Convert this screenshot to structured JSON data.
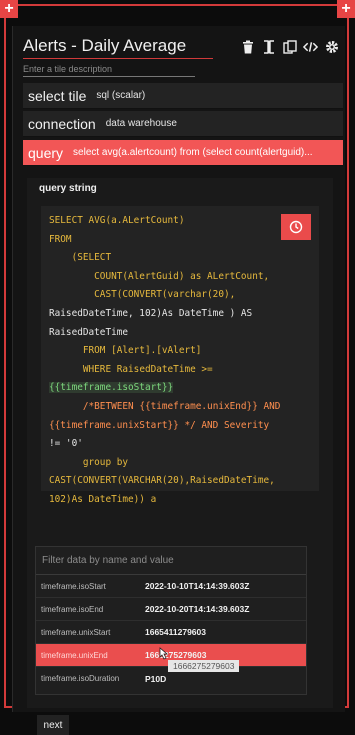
{
  "tile": {
    "title": "Alerts - Daily Average",
    "description_placeholder": "Enter a tile description"
  },
  "fields": [
    {
      "label": "select tile",
      "value": "sql (scalar)"
    },
    {
      "label": "connection",
      "value": "data warehouse"
    },
    {
      "label": "query",
      "value": "select avg(a.alertcount) from (select count(alertguid)..."
    }
  ],
  "query_section": {
    "label": "query string",
    "code_lines": [
      "SELECT AVG(a.ALertCount)",
      "FROM",
      "    (SELECT",
      "        COUNT(AlertGuid) as ALertCount,",
      "        CAST(CONVERT(varchar(20),",
      "RaisedDateTime, 102)As DateTime ) AS",
      "RaisedDateTime",
      "      FROM [Alert].[vAlert]",
      "      WHERE RaisedDateTime >=",
      "{{timeframe.isoStart}}",
      "      /*BETWEEN {{timeframe.unixEnd}} AND",
      "{{timeframe.unixStart}} */ AND Severity",
      "!= '0'",
      "      group by",
      "CAST(CONVERT(VARCHAR(20),RaisedDateTime,",
      "102)As DateTime)) a"
    ]
  },
  "variables": {
    "filter_placeholder": "Filter data by name and value",
    "rows": [
      {
        "name": "timeframe.isoStart",
        "value": "2022-10-10T14:14:39.603Z"
      },
      {
        "name": "timeframe.isoEnd",
        "value": "2022-10-20T14:14:39.603Z"
      },
      {
        "name": "timeframe.unixStart",
        "value": "1665411279603"
      },
      {
        "name": "timeframe.unixEnd",
        "value": "1666275279603"
      },
      {
        "name": "timeframe.isoDuration",
        "value": "P10D"
      }
    ],
    "tooltip": "1666275279603"
  },
  "buttons": {
    "next": "next",
    "corner_left": "+",
    "corner_right": "+"
  },
  "colors": {
    "accent": "#ea4b4b",
    "panel": "#141414",
    "keyword": "#e6b93d",
    "template_var": "#7dd87d"
  },
  "icons": [
    "trash-icon",
    "columns-icon",
    "copy-icon",
    "code-icon",
    "gear-icon",
    "clock-icon",
    "plus-icon"
  ]
}
